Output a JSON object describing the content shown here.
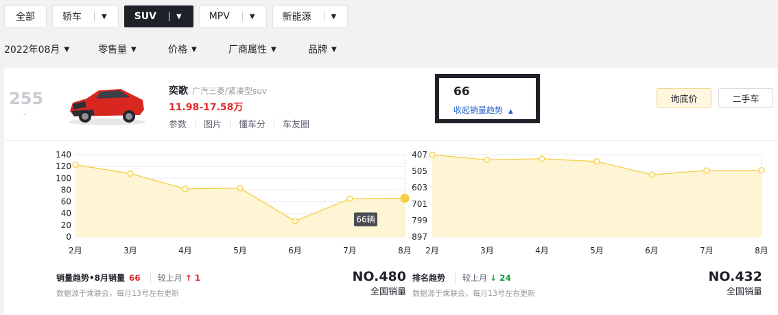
{
  "tabs": [
    {
      "label": "全部",
      "dropdown": false,
      "active": false
    },
    {
      "label": "轿车",
      "dropdown": true,
      "active": false
    },
    {
      "label": "SUV",
      "dropdown": true,
      "active": true
    },
    {
      "label": "MPV",
      "dropdown": true,
      "active": false
    },
    {
      "label": "新能源",
      "dropdown": true,
      "active": false
    }
  ],
  "filters": {
    "month": "2022年08月",
    "sales": "零售量",
    "price": "价格",
    "maker": "厂商属性",
    "brand": "品牌"
  },
  "car": {
    "rank": "255",
    "rank_change": "-",
    "name": "奕歌",
    "sub": "广汽三菱/紧凑型suv",
    "price": "11.98-17.58万",
    "links": [
      "参数",
      "图片",
      "懂车分",
      "车友圈"
    ],
    "body_color": "#d8271f"
  },
  "sales_box": {
    "number": "66",
    "toggle_label": "收起销量趋势",
    "toggle_icon": "triangle-up-icon"
  },
  "buttons": {
    "ask_price": "询底价",
    "used_car": "二手车"
  },
  "colors": {
    "line": "#f5cf45",
    "area": "#fdf2c8",
    "red": "#e02b2b",
    "green": "#1c9b47",
    "blue": "#2a63c6"
  },
  "chart_data": [
    {
      "type": "line",
      "title": "销量趋势•8月销量",
      "categories": [
        "2月",
        "3月",
        "4月",
        "5月",
        "6月",
        "7月",
        "8月"
      ],
      "values": [
        123,
        108,
        82,
        83,
        27,
        65,
        66
      ],
      "ylim": [
        0,
        140
      ],
      "yticks": [
        140,
        120,
        100,
        80,
        60,
        40,
        20,
        0
      ],
      "grid": true,
      "tooltip": {
        "category": "8月",
        "text": "66辆"
      }
    },
    {
      "type": "line",
      "title": "排名趋势",
      "categories": [
        "2月",
        "3月",
        "4月",
        "5月",
        "6月",
        "7月",
        "8月"
      ],
      "values": [
        407,
        437,
        431,
        447,
        526,
        501,
        500
      ],
      "ylim": [
        407,
        897
      ],
      "y_inverted": true,
      "yticks": [
        407,
        505,
        603,
        701,
        799,
        897
      ],
      "grid": true
    }
  ],
  "footer_left": {
    "title": "销量趋势•8月销量",
    "value": "66",
    "compare_label": "较上月",
    "compare_arrow": "↑",
    "compare_value": "1",
    "note": "数据源于乘联会，每月13号左右更新",
    "rank_no": "NO.480",
    "rank_label": "全国销量"
  },
  "footer_right": {
    "title": "排名趋势",
    "compare_label": "较上月",
    "compare_arrow": "↓",
    "compare_value": "24",
    "note": "数据源于乘联会，每月13号左右更新",
    "rank_no": "NO.432",
    "rank_label": "全国销量"
  }
}
